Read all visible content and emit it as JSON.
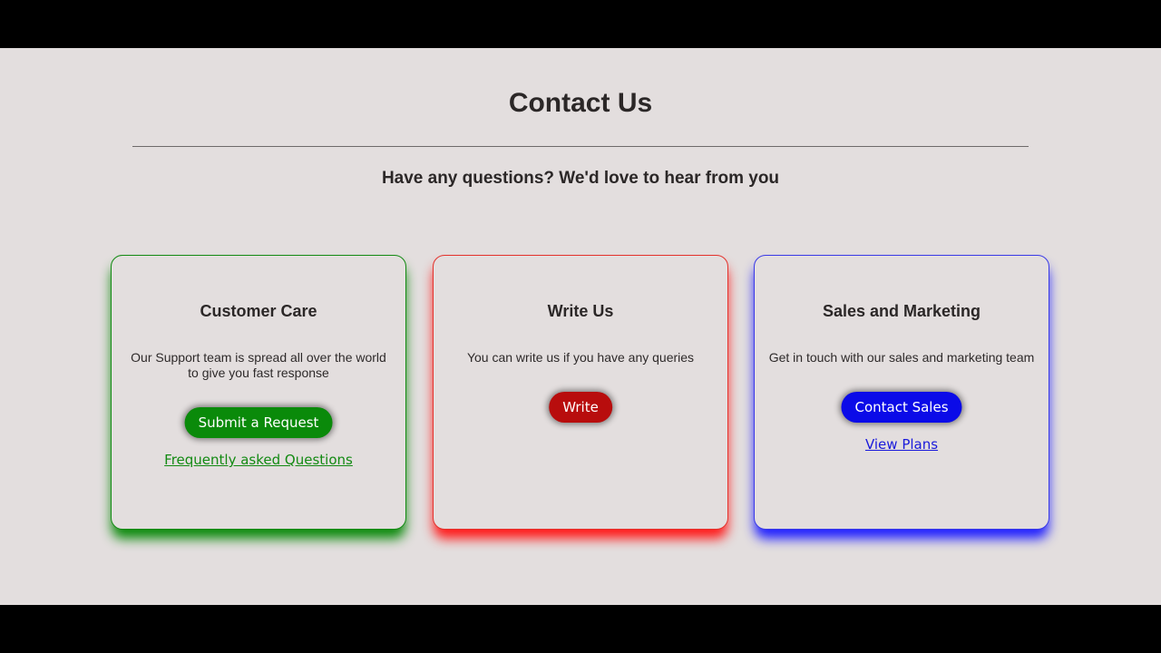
{
  "header": {
    "title": "Contact Us",
    "subtitle": "Have any questions? We'd love to hear from you"
  },
  "colors": {
    "page_bg": "#e3dede",
    "frame_bg": "#000000",
    "green": "#0a8a0a",
    "red": "#b80d0d",
    "blue": "#0b0be8"
  },
  "cards": [
    {
      "title": "Customer Care",
      "description": "Our Support team is spread all over the world to give you fast response",
      "button_label": "Submit a Request",
      "link_label": "Frequently asked Questions"
    },
    {
      "title": "Write Us",
      "description": "You can write us if you have any queries",
      "button_label": "Write"
    },
    {
      "title": "Sales and Marketing",
      "description": "Get in touch with our sales and marketing team",
      "button_label": "Contact Sales",
      "link_label": "View Plans"
    }
  ]
}
